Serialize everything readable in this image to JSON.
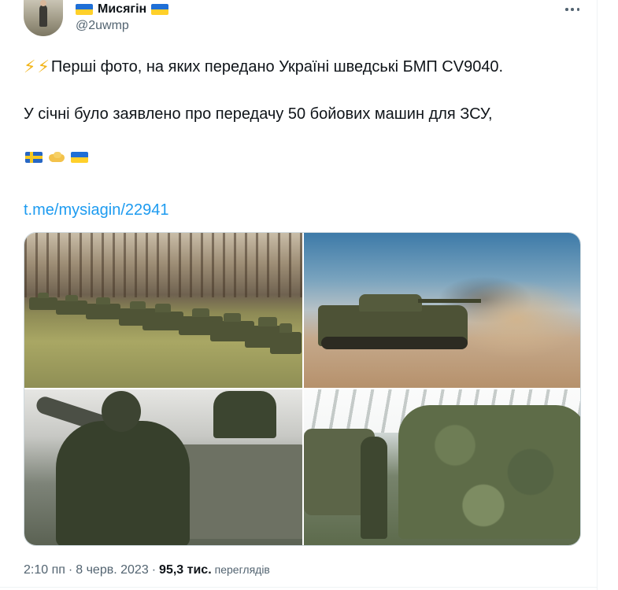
{
  "author": {
    "display_name": "Мисягін",
    "handle": "@2uwmp",
    "name_flag": "ukraine-flag"
  },
  "tweet": {
    "line1": "Перші фото, на яких передано Україні шведські БМП CV9040.",
    "line1_prefix_icons": [
      "lightning-icon",
      "lightning-icon"
    ],
    "line2": "У січні було заявлено про передачу 50 бойових машин для ЗСУ,",
    "emoji_row": [
      "sweden-flag",
      "handshake-icon",
      "ukraine-flag"
    ],
    "link": "t.me/mysiagin/22941"
  },
  "media": {
    "photos": [
      {
        "subject": "convoy-of-vehicles-in-field"
      },
      {
        "subject": "vehicle-firing-in-dust"
      },
      {
        "subject": "soldier-beside-vehicle"
      },
      {
        "subject": "camouflaged-vehicle-in-hangar"
      }
    ]
  },
  "meta": {
    "time": "2:10 пп",
    "date": "8 черв. 2023",
    "separator": "·",
    "views_count": "95,3 тис.",
    "views_label": "переглядів"
  },
  "colors": {
    "text": "#0f1419",
    "muted": "#536471",
    "link": "#1d9bf0",
    "border": "#cfd9de"
  }
}
